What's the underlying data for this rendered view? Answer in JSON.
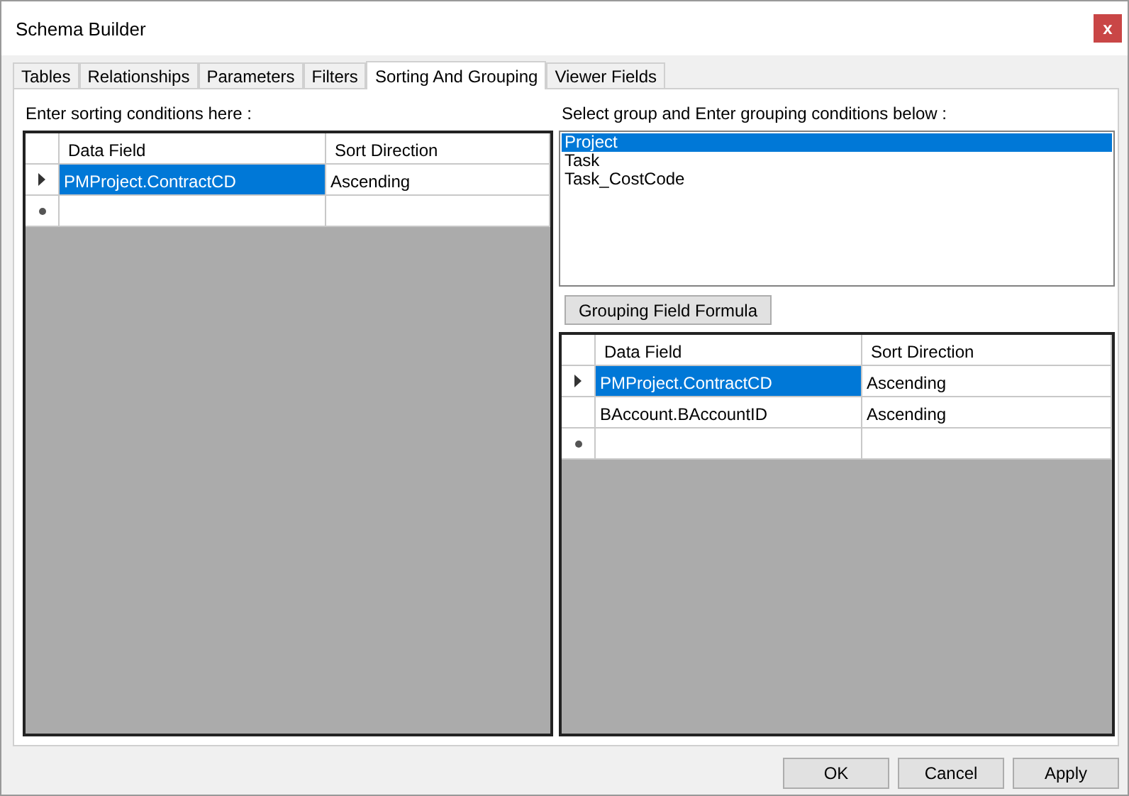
{
  "window": {
    "title": "Schema Builder",
    "close": "x"
  },
  "tabs": [
    {
      "label": "Tables",
      "selected": false
    },
    {
      "label": "Relationships",
      "selected": false
    },
    {
      "label": "Parameters",
      "selected": false
    },
    {
      "label": "Filters",
      "selected": false
    },
    {
      "label": "Sorting And Grouping",
      "selected": true
    },
    {
      "label": "Viewer Fields",
      "selected": false
    }
  ],
  "sorting": {
    "label": "Enter sorting conditions here :",
    "columns": [
      "Data Field",
      "Sort Direction"
    ],
    "rows": [
      {
        "kind": "data",
        "current": true,
        "selected": true,
        "cells": [
          "PMProject.ContractCD",
          "Ascending"
        ]
      },
      {
        "kind": "new",
        "current": false,
        "selected": false,
        "cells": []
      }
    ]
  },
  "grouping": {
    "label": "Select group and Enter grouping conditions below :",
    "groups": [
      {
        "label": "Project",
        "selected": true
      },
      {
        "label": "Task",
        "selected": false
      },
      {
        "label": "Task_CostCode",
        "selected": false
      }
    ],
    "formula_button": "Grouping Field Formula",
    "columns": [
      "Data Field",
      "Sort Direction"
    ],
    "rows": [
      {
        "kind": "data",
        "current": true,
        "selected": true,
        "cells": [
          "PMProject.ContractCD",
          "Ascending"
        ]
      },
      {
        "kind": "data",
        "current": false,
        "selected": false,
        "cells": [
          "BAccount.BAccountID",
          "Ascending"
        ]
      },
      {
        "kind": "new",
        "current": false,
        "selected": false,
        "cells": []
      }
    ]
  },
  "buttons": [
    "OK",
    "Cancel",
    "Apply"
  ]
}
